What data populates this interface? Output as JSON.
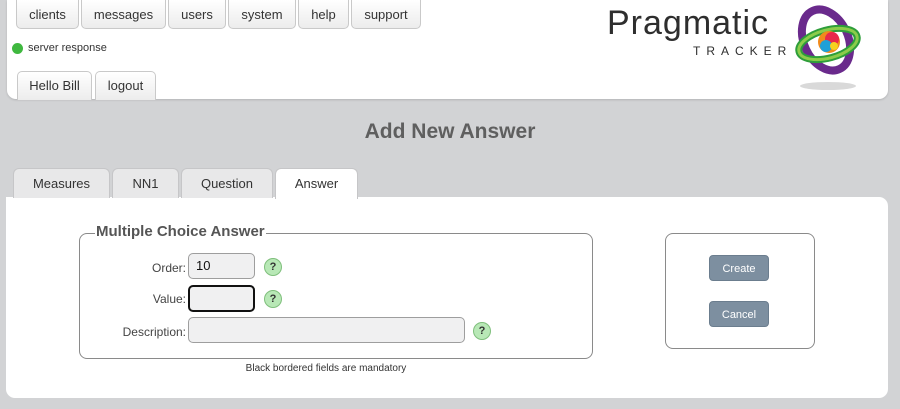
{
  "nav": {
    "clients": "clients",
    "messages": "messages",
    "users": "users",
    "system": "system",
    "help": "help",
    "support": "support"
  },
  "status": {
    "text": "server response",
    "color": "#3fb83f"
  },
  "user": {
    "greeting": "Hello Bill",
    "logout": "logout"
  },
  "logo": {
    "name": "Pragmatic",
    "sub": "TRACKER"
  },
  "page": {
    "title": "Add New Answer"
  },
  "tabs": {
    "measures": "Measures",
    "nn1": "NN1",
    "question": "Question",
    "answer": "Answer",
    "active": "Answer"
  },
  "form": {
    "legend": "Multiple Choice Answer",
    "order": {
      "label": "Order:",
      "value": "10"
    },
    "value": {
      "label": "Value:",
      "value": ""
    },
    "description": {
      "label": "Description:",
      "value": ""
    },
    "help_glyph": "?",
    "note": "Black bordered fields are mandatory"
  },
  "actions": {
    "create": "Create",
    "cancel": "Cancel"
  },
  "colors": {
    "background": "#d2d3d5",
    "button": "#7d8fa0",
    "help_badge": "#b8e8b6",
    "status_ok": "#3fb83f"
  }
}
